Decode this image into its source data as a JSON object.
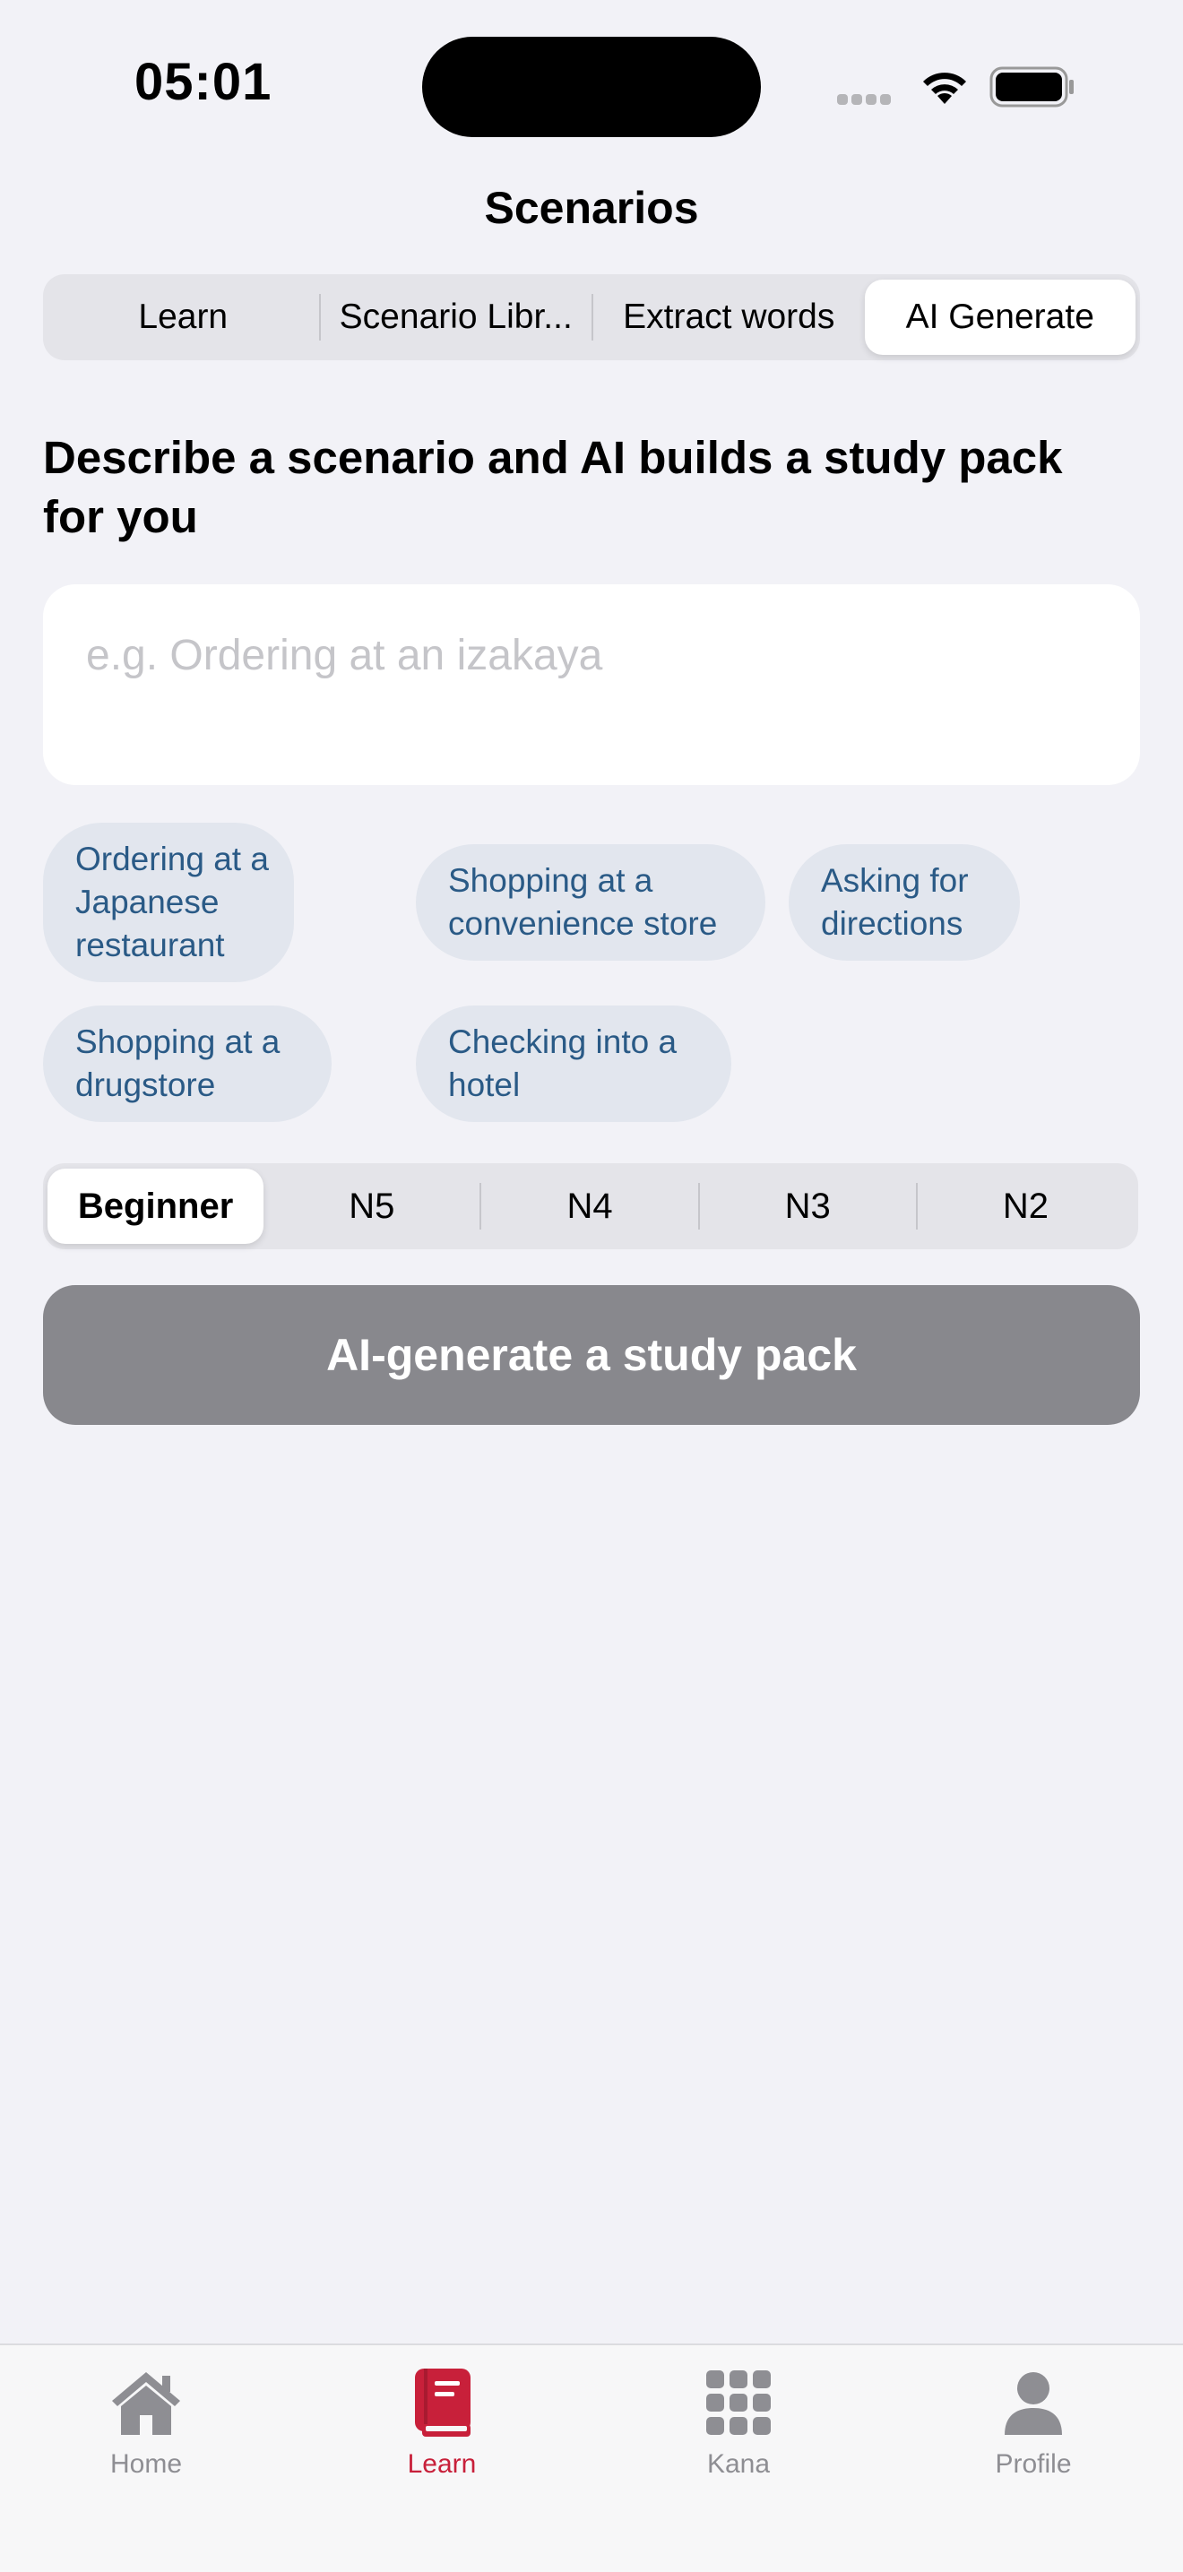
{
  "status": {
    "time": "05:01"
  },
  "nav": {
    "title": "Scenarios"
  },
  "tabs": [
    {
      "label": "Learn",
      "active": false
    },
    {
      "label": "Scenario Libr...",
      "active": false
    },
    {
      "label": "Extract words",
      "active": false
    },
    {
      "label": "AI Generate",
      "active": true
    }
  ],
  "heading": "Describe a scenario and AI builds a study pack for you",
  "scenario_input": {
    "value": "",
    "placeholder": "e.g. Ordering at an izakaya"
  },
  "suggestions": [
    "Ordering at a Japanese restaurant",
    "Shopping at a convenience store",
    "Asking for directions",
    "Shopping at a drugstore",
    "Checking into a hotel"
  ],
  "levels": [
    {
      "label": "Beginner",
      "active": true
    },
    {
      "label": "N5",
      "active": false
    },
    {
      "label": "N4",
      "active": false
    },
    {
      "label": "N3",
      "active": false
    },
    {
      "label": "N2",
      "active": false
    }
  ],
  "generate_button": "AI-generate a study pack",
  "tab_bar": [
    {
      "label": "Home",
      "icon": "house-icon",
      "active": false
    },
    {
      "label": "Learn",
      "icon": "book-icon",
      "active": true
    },
    {
      "label": "Kana",
      "icon": "grid-icon",
      "active": false
    },
    {
      "label": "Profile",
      "icon": "person-icon",
      "active": false
    }
  ],
  "colors": {
    "accent": "#c8203a",
    "chip_text": "#2a5a86",
    "chip_bg": "#e2e6ee",
    "button_disabled": "#88888d",
    "background": "#f2f2f7"
  }
}
